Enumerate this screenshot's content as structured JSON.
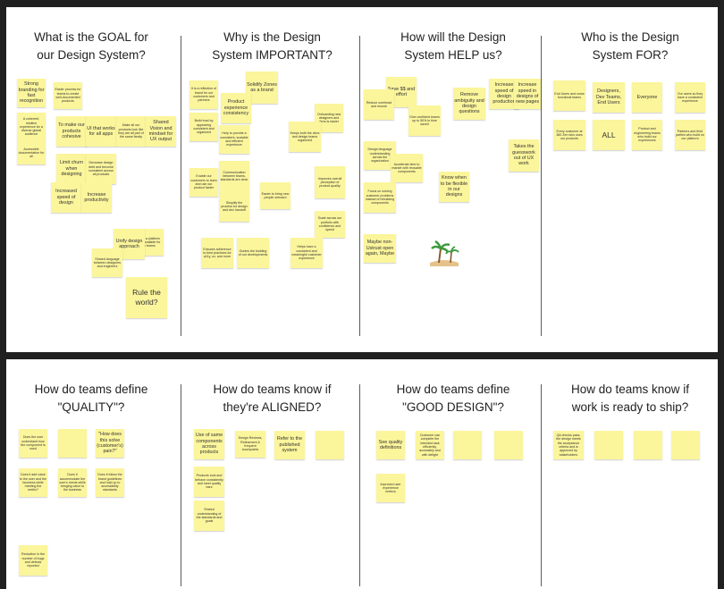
{
  "colors": {
    "board": "#ffffff",
    "background": "#202020",
    "sticky": "#fbf59c",
    "divider": "#5b5b5b"
  },
  "top": {
    "questions": [
      {
        "line1": "What is the GOAL for",
        "line2": "our Design System?"
      },
      {
        "line1": "Why is the Design",
        "line2": "System IMPORTANT?"
      },
      {
        "line1": "How will the Design",
        "line2": "System HELP us?"
      },
      {
        "line1": "Who is the Design",
        "line2": "System FOR?"
      }
    ],
    "col1": {
      "notes": [
        "Strong branding for fast recognition",
        "Easier process for teams to create well-documented products",
        "A coherent, intuitive experience for a diverse global audience",
        "To make our products cohesive",
        "UI that works for all apps",
        "Make all our products look like they are all part of the same family",
        "Shared Vision and mindset for UX output",
        "Accessible documentation for all",
        "Limit churn when designing",
        "Decrease design debt and become consistent across all products",
        "Increased speed of design",
        "Increase productivity",
        "Create a platform that is scalable for new teams",
        "Unify design approach",
        "Shared language between designers and engineers",
        "Rule the world?"
      ]
    },
    "col2": {
      "notes": [
        "Solidify Zones as a brand",
        "It is a reflection of brand for our customers and partners",
        "Product experience consistency",
        "Build trust by appearing consistent and organized",
        "Help to provide a consistent, scalable and efficient experience",
        "Onboarding new designers and devs is easier",
        "Keeps both the devs and design teams organized",
        "Communication between teams, standards are clear",
        "Enable our customers to learn and use our product faster",
        "Easier to bring new people onboard",
        "Simplify the process for design and dev handoff",
        "Improves overall perception of product quality",
        "Scale across our portfolio with confidence and speed",
        "Ensures adherence to best practices for a11y, ux, and more",
        "Guides the building of our developments",
        "Helps have a consistent and meaningful customer experience",
        "Allows us to experiment with new patterns more quickly"
      ]
    },
    "col3": {
      "notes": [
        "Save $$ and effort",
        "Reduce overhead and rework",
        "Remove ambiguity and design questions",
        "Increase speed of design production",
        "Increase speed in designs of new pages",
        "Give confident teams up to 50% in time saved",
        "Design language understanding across the organization",
        "Accelerate time to market with reusable components",
        "Know when to be flexible in our designs",
        "Takes the guesswork out of UX work",
        "Maybe non-Ustrust open again, Maybe",
        "Focus on solving customer problems instead of rebuilding components"
      ]
    },
    "col4": {
      "notes": [
        "End Users and cross functional teams",
        "Designers, Dev Teams, End Users",
        "Everyone",
        "Our users so they have a consistent experience",
        "Every customer at 360 Zen who uses our products",
        "ALL",
        "Product and engineering teams who build our experiences",
        "Partners and third parties who build on our platform"
      ]
    }
  },
  "bottom": {
    "questions": [
      {
        "line1": "How do teams define",
        "line2": "\"QUALITY\"?"
      },
      {
        "line1": "How do teams know if",
        "line2": "they're ALIGNED?"
      },
      {
        "line1": "How do teams define",
        "line2": "\"GOOD DESIGN\"?"
      },
      {
        "line1": "How do teams know if",
        "line2": "work is ready to ship?"
      }
    ],
    "col1": {
      "notes": [
        "Does the user understand how the component is used",
        "\"How does this solve (customer's) pain?\"",
        "Does it add value to the user and the business while meeting the metric?",
        "Does it accommodate the user's needs while bringing value to the business",
        "Does it follow the brand guidelines and hold up to accessibility standards",
        "Reduction in the number of bugs and defects reported"
      ]
    },
    "col2": {
      "notes": [
        "Use of same components across products",
        "Design Reviews, Refinement & frequent touchpoints",
        "Refer to the published system",
        "Products look and behave consistently and meet quality bars",
        "Shared understanding of the standards and goals"
      ]
    },
    "col3": {
      "notes": [
        "See quality definitions",
        "Customer can complete the intended task efficiently, accessibly and with delight",
        "Improved user experience metrics"
      ]
    },
    "col4": {
      "notes": [
        "QA checks pass, the design meets the acceptance criteria and is approved by stakeholders"
      ]
    }
  }
}
